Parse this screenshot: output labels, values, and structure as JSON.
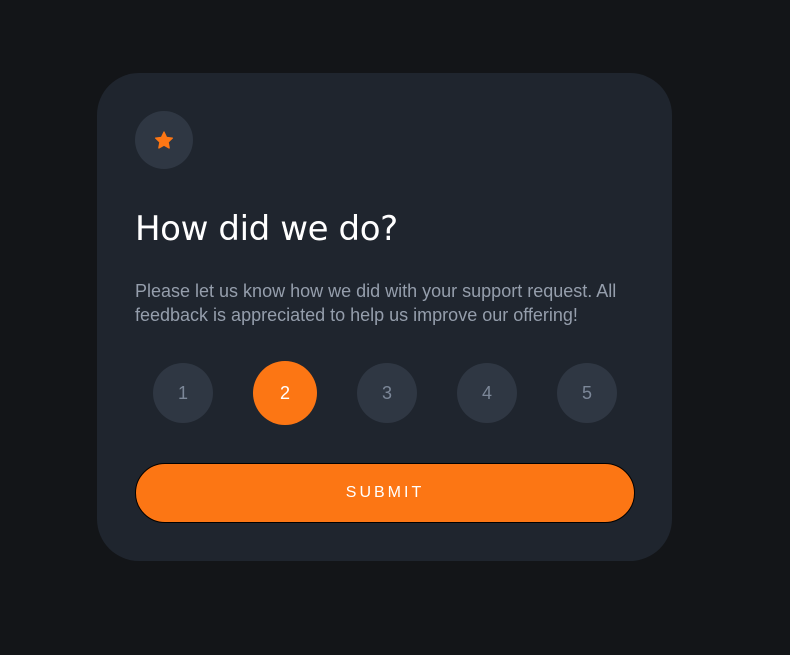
{
  "card": {
    "icon": "star-icon",
    "title": "How did we do?",
    "description": "Please let us know how we did with your support request. All feedback is appreciated to help us improve our offering!",
    "ratings": [
      "1",
      "2",
      "3",
      "4",
      "5"
    ],
    "selected_rating": "2",
    "submit_label": "SUBMIT"
  },
  "colors": {
    "background": "#131518",
    "card": "#1f252e",
    "circle": "#2f3743",
    "accent": "#fc7614",
    "text_muted": "#959eac",
    "text_white": "#ffffff"
  }
}
